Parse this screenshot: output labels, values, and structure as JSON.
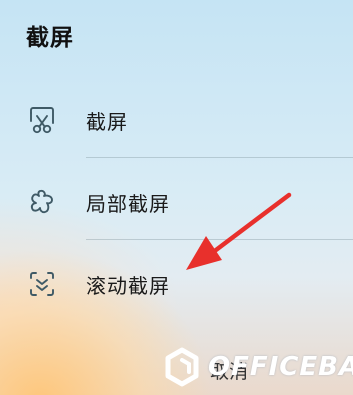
{
  "panel": {
    "title": "截屏"
  },
  "menu": {
    "items": [
      {
        "label": "截屏",
        "icon": "scissors-screenshot-icon"
      },
      {
        "label": "局部截屏",
        "icon": "partial-screenshot-icon"
      },
      {
        "label": "滚动截屏",
        "icon": "scroll-screenshot-icon"
      }
    ]
  },
  "footer": {
    "partial_label": "取消"
  },
  "watermark": {
    "text": "OFFICEBA"
  },
  "annotation": {
    "arrow_color": "#e8302c"
  }
}
